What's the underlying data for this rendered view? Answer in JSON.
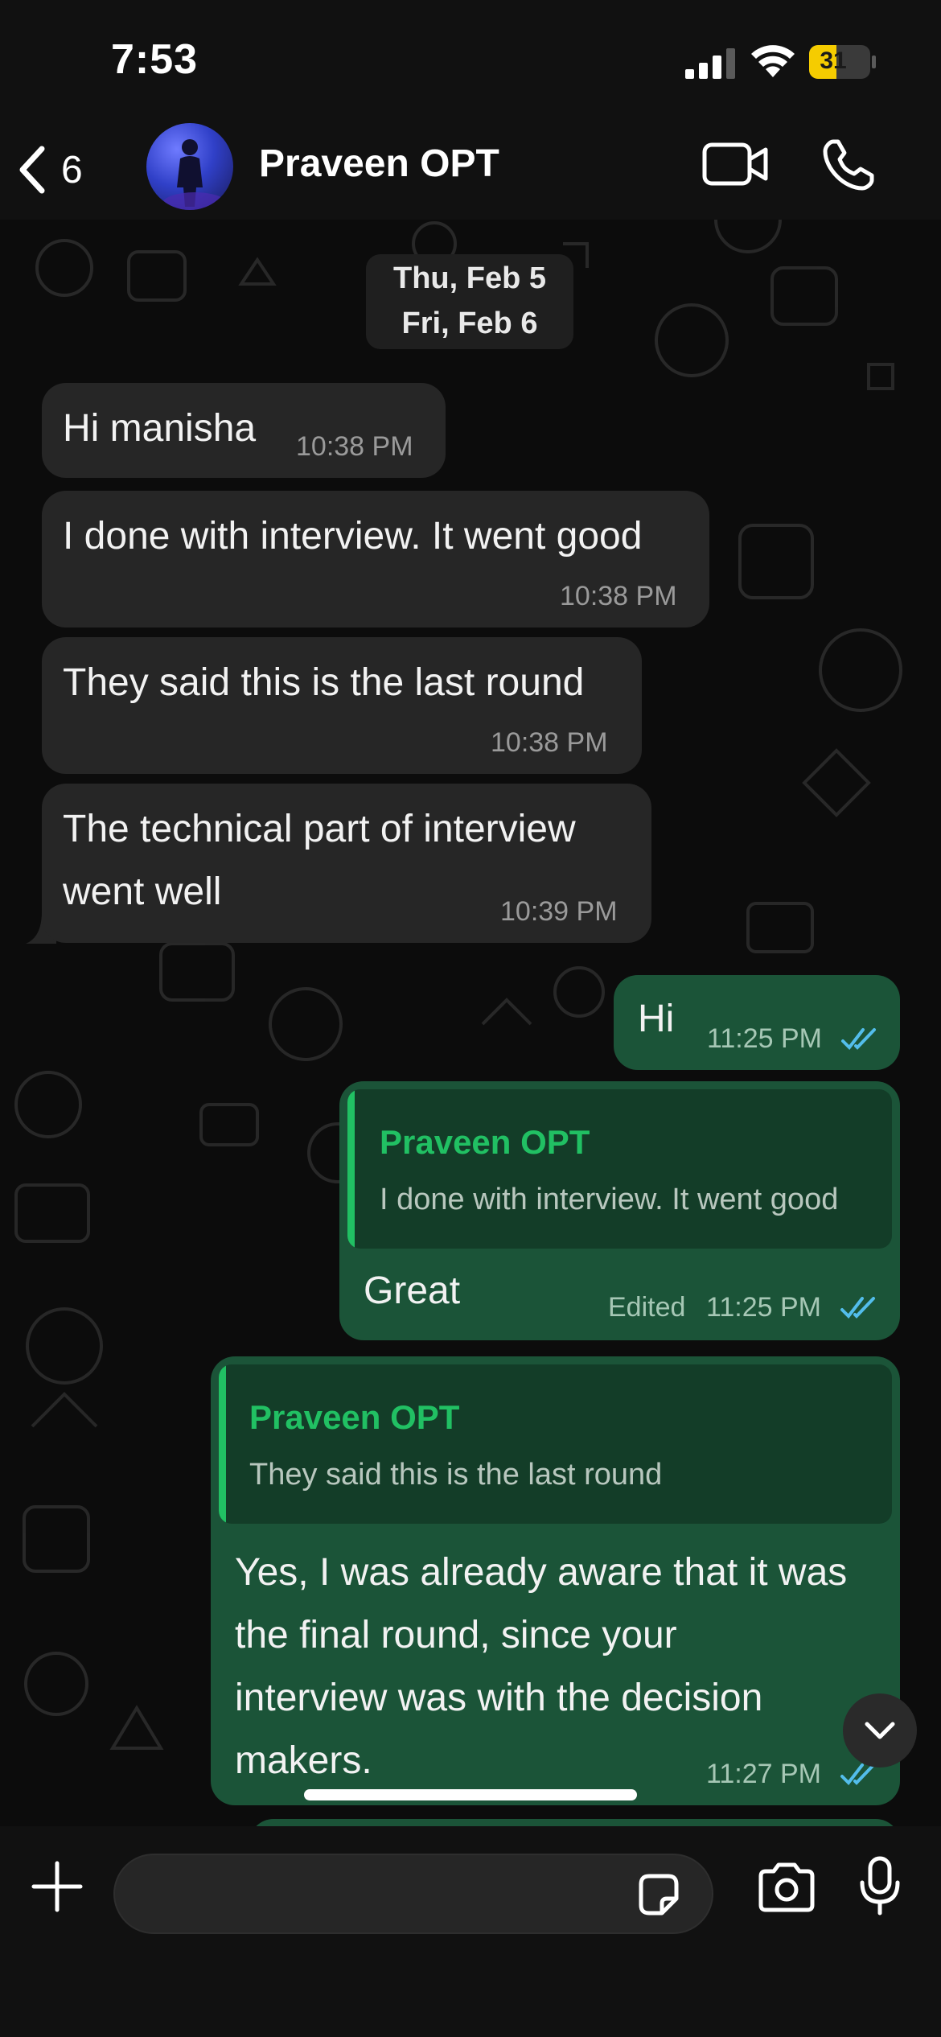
{
  "status_bar": {
    "time": "7:53",
    "battery_level": "31",
    "battery_color": "#f5cc00"
  },
  "header": {
    "back_count": "6",
    "contact_name": "Praveen OPT"
  },
  "date_separator": {
    "line1": "Thu, Feb 5",
    "line2": "Fri, Feb 6"
  },
  "messages": [
    {
      "direction": "incoming",
      "text": "Hi manisha",
      "time": "10:38 PM"
    },
    {
      "direction": "incoming",
      "text": "I done with interview. It went good",
      "time": "10:38 PM"
    },
    {
      "direction": "incoming",
      "text": "They said this is the last round",
      "time": "10:38 PM"
    },
    {
      "direction": "incoming",
      "text_line1": "The technical part of interview",
      "text_line2": "went well",
      "time": "10:39 PM"
    },
    {
      "direction": "outgoing",
      "text": "Hi",
      "time": "11:25 PM",
      "status": "read"
    },
    {
      "direction": "outgoing",
      "reply_to": {
        "name": "Praveen OPT",
        "text": "I done with interview. It went good"
      },
      "text": "Great",
      "edited_label": "Edited",
      "time": "11:25 PM",
      "status": "read"
    },
    {
      "direction": "outgoing",
      "reply_to": {
        "name": "Praveen OPT",
        "text": "They said this is the last round"
      },
      "text_line1": "Yes, I was already aware that it was",
      "text_line2": "the final round, since your",
      "text_line3": "interview was with the decision",
      "text_line4": "makers.",
      "time": "11:27 PM",
      "status": "read"
    }
  ],
  "colors": {
    "incoming_bubble": "#262626",
    "outgoing_bubble": "#1b5438",
    "accent_green": "#21c063",
    "read_ticks": "#53bdeb"
  },
  "input": {
    "placeholder": ""
  }
}
